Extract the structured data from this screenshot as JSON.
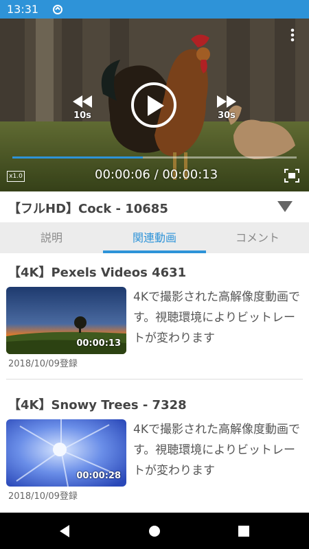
{
  "status_bar": {
    "time": "13:31"
  },
  "player": {
    "skip_back_label": "10s",
    "skip_forward_label": "30s",
    "speed": "x1.0",
    "time_display": "00:00:06 / 00:00:13",
    "progress_fraction": 0.46
  },
  "video": {
    "title": "【フルHD】Cock - 10685"
  },
  "tabs": [
    {
      "label": "説明",
      "active": false
    },
    {
      "label": "関連動画",
      "active": true
    },
    {
      "label": "コメント",
      "active": false
    }
  ],
  "related": [
    {
      "title": "【4K】Pexels Videos 4631",
      "duration": "00:00:13",
      "description": "4Kで撮影された高解像度動画です。視聴環境によりビットレートが変わります",
      "date": "2018/10/09登録"
    },
    {
      "title": "【4K】Snowy Trees - 7328",
      "duration": "00:00:28",
      "description": "4Kで撮影された高解像度動画です。視聴環境によりビットレートが変わります",
      "date": "2018/10/09登録"
    }
  ],
  "colors": {
    "accent": "#2e93d8",
    "status_bar": "#2e93d8",
    "tab_bar": "#ececec"
  }
}
